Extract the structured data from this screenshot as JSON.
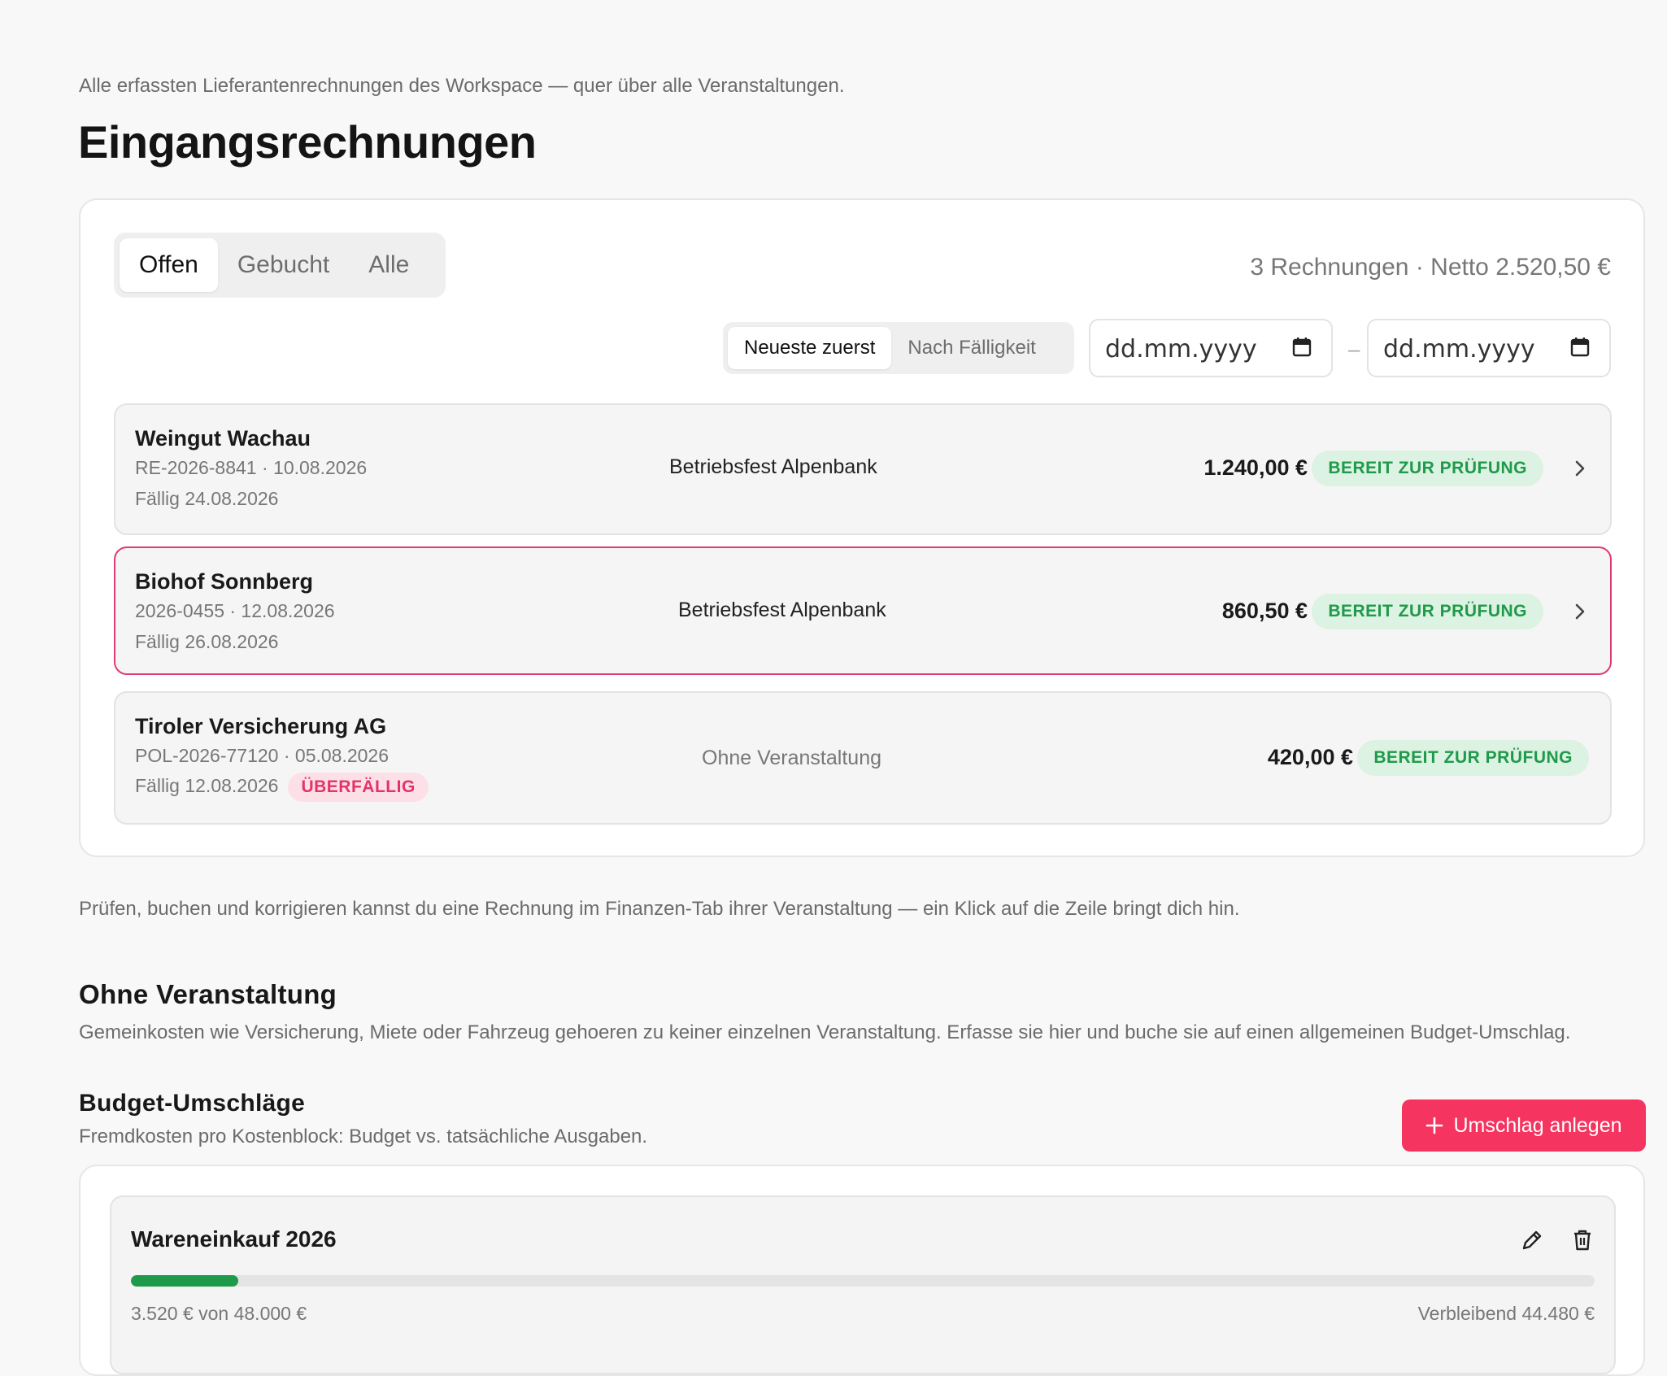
{
  "header": {
    "subtitle": "Alle erfassten Lieferantenrechnungen des Workspace — quer über alle Veranstaltungen.",
    "title": "Eingangsrechnungen"
  },
  "tabs": [
    {
      "label": "Offen",
      "active": true
    },
    {
      "label": "Gebucht",
      "active": false
    },
    {
      "label": "Alle",
      "active": false
    }
  ],
  "summary": "3 Rechnungen · Netto 2.520,50 €",
  "sort": {
    "newest": "Neueste zuerst",
    "due": "Nach Fälligkeit"
  },
  "date_filter": {
    "from_placeholder": "dd.mm.yyyy",
    "to_placeholder": "dd.mm.yyyy",
    "separator": "–"
  },
  "invoices": [
    {
      "vendor": "Weingut Wachau",
      "meta": "RE-2026-8841 · 10.08.2026",
      "due": "Fällig 24.08.2026",
      "event": "Betriebsfest Alpenbank",
      "amount": "1.240,00 €",
      "status": "BEREIT ZUR PRÜFUNG"
    },
    {
      "vendor": "Biohof Sonnberg",
      "meta": "2026-0455 · 12.08.2026",
      "due": "Fällig 26.08.2026",
      "event": "Betriebsfest Alpenbank",
      "amount": "860,50 €",
      "status": "BEREIT ZUR PRÜFUNG"
    },
    {
      "vendor": "Tiroler Versicherung AG",
      "meta": "POL-2026-77120 · 05.08.2026",
      "due": "Fällig 12.08.2026",
      "overdue": "ÜBERFÄLLIG",
      "event": "Ohne Veranstaltung",
      "amount": "420,00 €",
      "status": "BEREIT ZUR PRÜFUNG"
    }
  ],
  "hint": "Prüfen, buchen und korrigieren kannst du eine Rechnung im Finanzen-Tab ihrer Veranstaltung — ein Klick auf die Zeile bringt dich hin.",
  "no_event": {
    "title": "Ohne Veranstaltung",
    "description": "Gemeinkosten wie Versicherung, Miete oder Fahrzeug gehoeren zu keiner einzelnen Veranstaltung. Erfasse sie hier und buche sie auf einen allgemeinen Budget-Umschlag."
  },
  "budgets": {
    "title": "Budget-Umschläge",
    "description": "Fremdkosten pro Kostenblock: Budget vs. tatsächliche Ausgaben.",
    "add_label": "Umschlag anlegen",
    "envelopes": [
      {
        "name": "Wareneinkauf 2026",
        "spent_text": "3.520 € von 48.000 €",
        "remaining_text": "Verbleibend 44.480 €",
        "progress_fraction": 0.0733
      }
    ]
  },
  "colors": {
    "accent": "#f5345f",
    "selected_border": "#e13b6d",
    "status_green": "#1f9a4a",
    "status_green_bg": "#dcf2e2",
    "overdue_red": "#e2336a"
  }
}
